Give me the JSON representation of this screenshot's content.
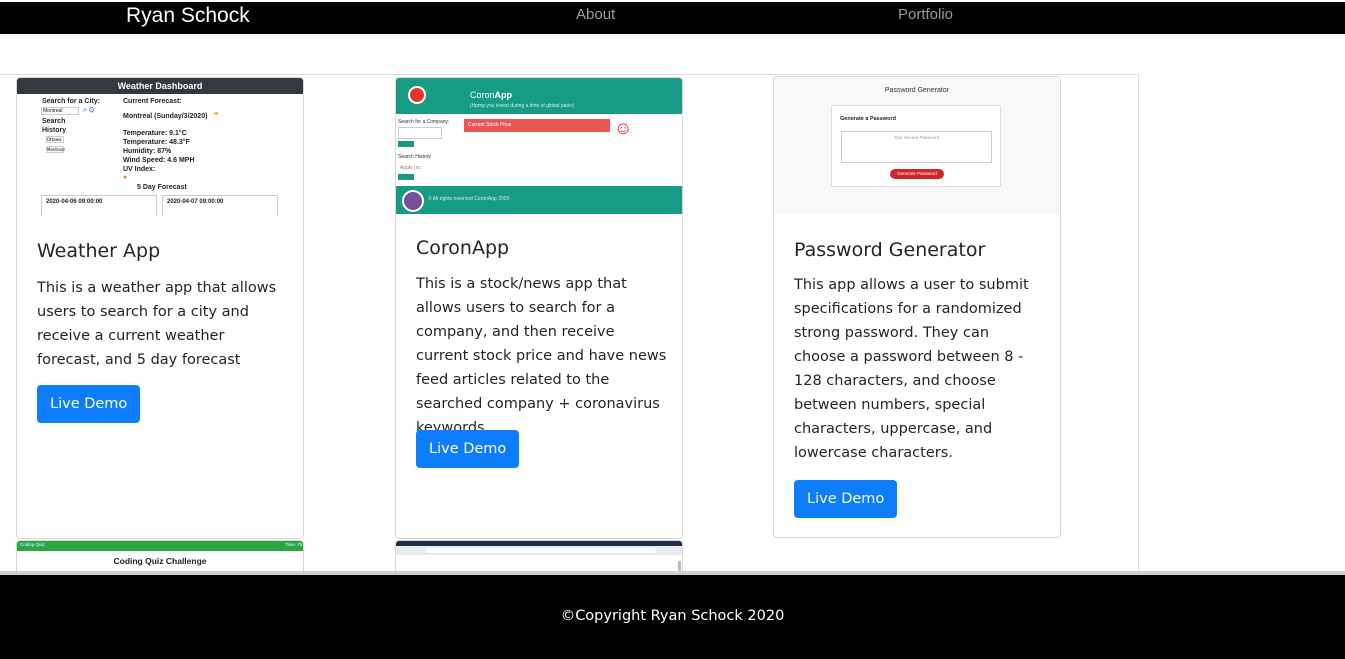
{
  "nav": {
    "brand": "Ryan Schock",
    "about": "About",
    "portfolio": "Portfolio"
  },
  "cards": [
    {
      "title": "Weather App",
      "text": "This is a weather app that allows users to search for a city and receive a current weather forecast, and 5 day forecast",
      "button": "Live Demo",
      "screenshot": {
        "header": "Weather Dashboard",
        "search_label": "Search for a City:",
        "search_value": "Montreal",
        "history_label": "Search History",
        "history_items": [
          "Ottawa",
          "Montreal"
        ],
        "current_label": "Current Forecast:",
        "city": "Montreal (Sunday/3/2020)",
        "lines": [
          "Temperature: 9.1°C",
          "Temperature: 48.3°F",
          "Humidity: 87%",
          "Wind Speed: 4.6 MPH",
          "UV Index:"
        ],
        "five_day": "5 Day Forecast",
        "dates": [
          "2020-04-06 09:00:00",
          "2020-04-07 09:00:00"
        ]
      }
    },
    {
      "title": "CoronApp",
      "text": "This is a stock/news app that allows users to search for a company, and then receive current stock price and have news feed articles related to the searched company + coronavirus keywords",
      "button": "Live Demo",
      "screenshot": {
        "title_light": "Coron",
        "title_bold": "App",
        "subtitle": "(Hpmp you invest during a time of global panic)",
        "search_label": "Search for a Company:",
        "red_bar": "Current Stock Price",
        "search_btn": "Search",
        "history_label": "Search History",
        "history_item": "Apple Inc",
        "footer": "© All rights reserved CoronApp 2020"
      }
    },
    {
      "title": "Password Generator",
      "text": "This app allows a user to submit specifications for a randomized strong password. They can choose a password between 8 - 128 characters, and choose between numbers, special characters, uppercase, and lowercase characters.",
      "button": "Live Demo",
      "screenshot": {
        "title": "Password Generator",
        "card_title": "Generate a Password",
        "placeholder": "Your Secure Password",
        "button": "Generate Password"
      }
    },
    {
      "screenshot": {
        "header_left": "Coding Quiz",
        "header_right": "Time: 75",
        "title": "Coding Quiz Challenge"
      }
    }
  ],
  "footer": {
    "text": "©Copyright Ryan Schock 2020"
  },
  "colors": {
    "navbar": "#000000",
    "button": "#0d7dfc",
    "teal": "#179b82",
    "quiz_green": "#28a745"
  }
}
